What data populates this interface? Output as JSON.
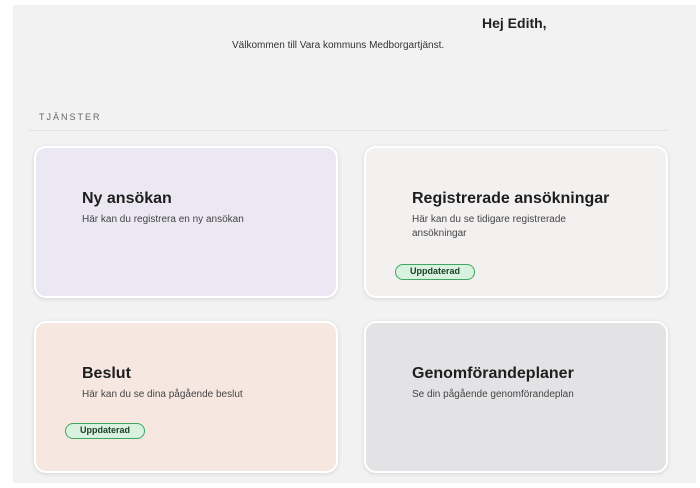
{
  "header": {
    "greeting": "Hej Edith,",
    "welcome": "Välkommen till Vara kommuns Medborgartjänst."
  },
  "section": {
    "label": "TJÄNSTER"
  },
  "cards": [
    {
      "title": "Ny ansökan",
      "description": "Här kan du registrera en ny ansökan",
      "badge": "",
      "color": "#ebe7f3"
    },
    {
      "title": "Registrerade ansökningar",
      "description": "Här kan du se tidigare registrerade ansökningar",
      "badge": "Uppdaterad",
      "color": "#f3f0f0"
    },
    {
      "title": "Beslut",
      "description": "Här kan du se dina pågående beslut",
      "badge": "Uppdaterad",
      "color": "#f6e8e1"
    },
    {
      "title": "Genomförandeplaner",
      "description": "Se din pågående genomförandeplan",
      "badge": "",
      "color": "#e3e3e6"
    }
  ],
  "colors": {
    "badge_border": "#3ea65e",
    "badge_fill": "#d8f2df",
    "page_background": "#f2f2f2"
  }
}
